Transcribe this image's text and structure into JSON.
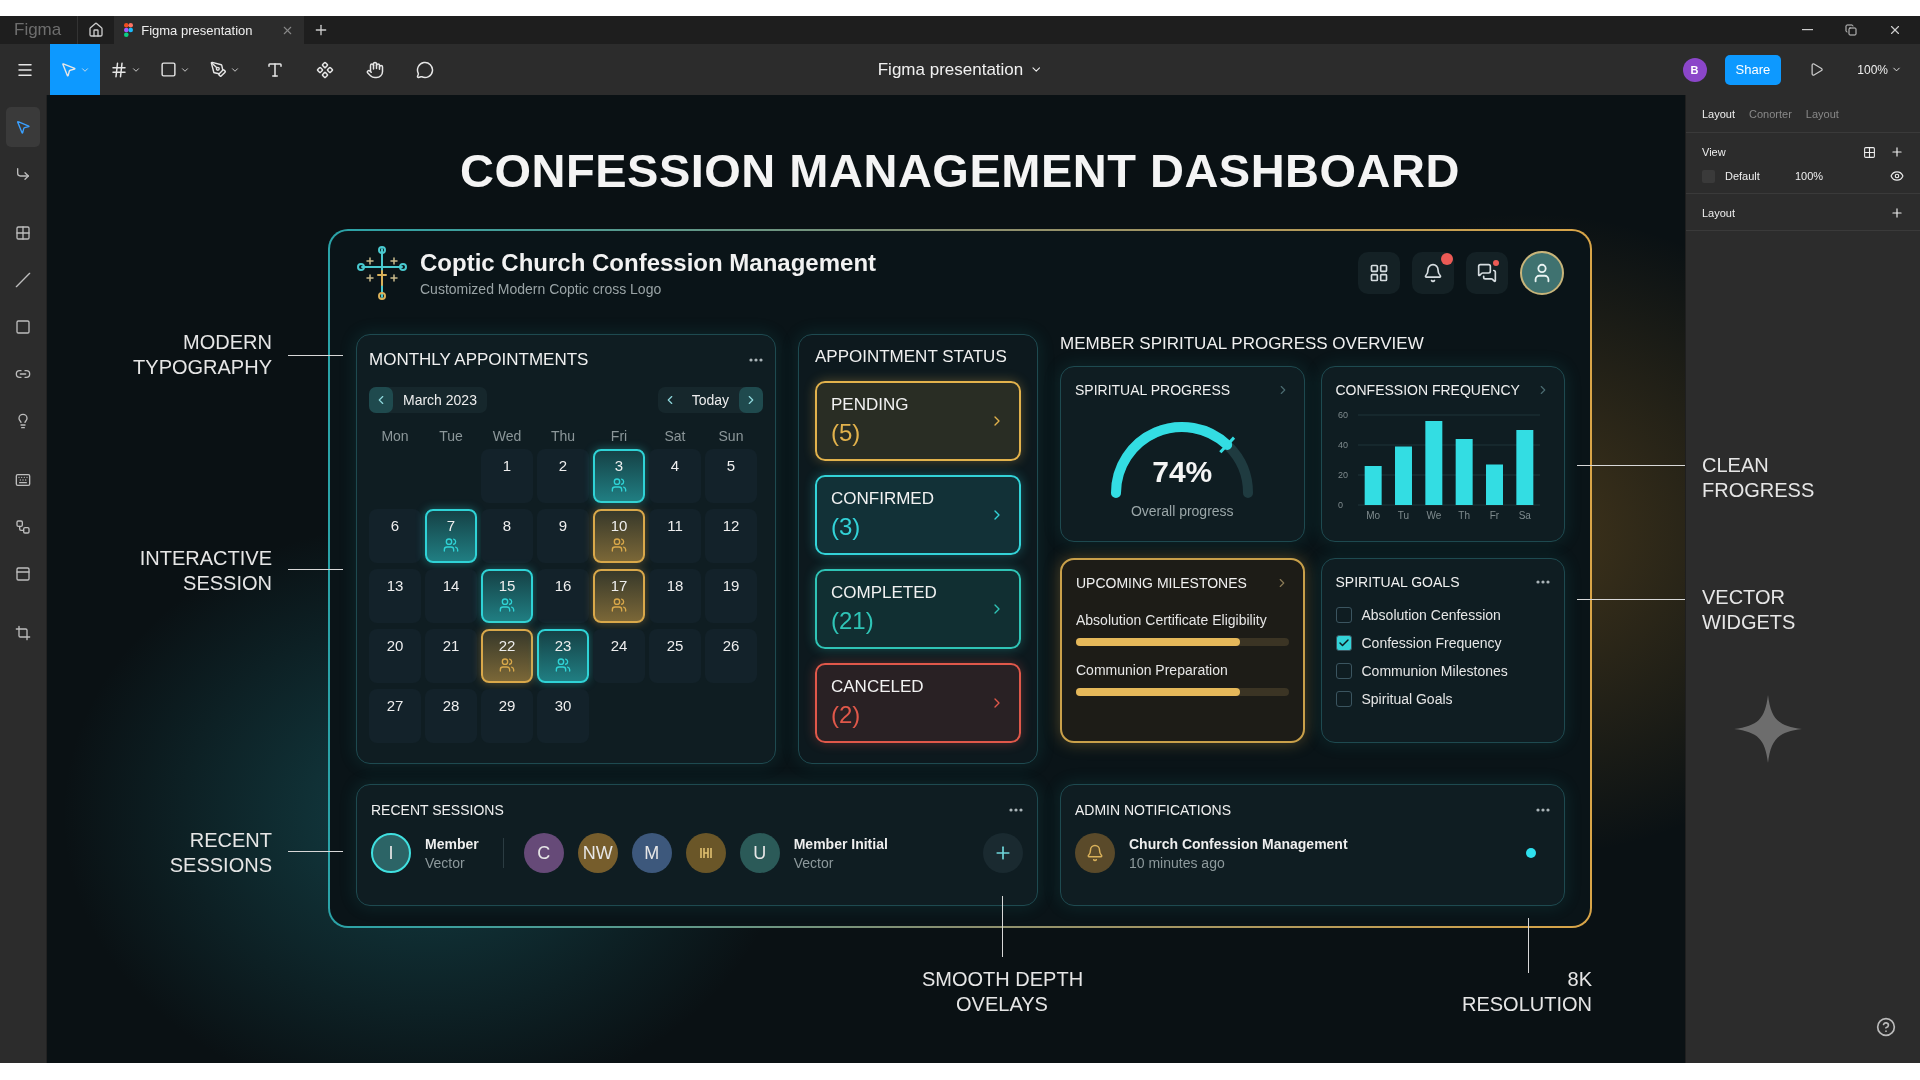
{
  "window": {
    "app_name": "Figma",
    "tab": {
      "title": "Figma presentation",
      "selected": true
    }
  },
  "toolbar": {
    "tools": [
      {
        "kind": "move",
        "selected": true,
        "caret": true
      },
      {
        "kind": "frame",
        "selected": false,
        "caret": true
      },
      {
        "kind": "shape",
        "selected": false,
        "caret": true
      },
      {
        "kind": "pen",
        "selected": false,
        "caret": true
      },
      {
        "kind": "text",
        "selected": false,
        "caret": false
      },
      {
        "kind": "component",
        "selected": false,
        "caret": false
      },
      {
        "kind": "hand",
        "selected": false,
        "caret": false
      },
      {
        "kind": "comment",
        "selected": false,
        "caret": false
      }
    ],
    "file_title": "Figma presentation",
    "user_initial": "B",
    "share_label": "Share",
    "zoom": "100%"
  },
  "side_tools": [
    {
      "kind": "pointer",
      "selected": true
    },
    {
      "kind": "connector",
      "selected": false
    },
    {
      "kind": "grid",
      "selected": false
    },
    {
      "kind": "line",
      "selected": false
    },
    {
      "kind": "rectangle",
      "selected": false
    },
    {
      "kind": "link",
      "selected": false
    },
    {
      "kind": "bulb",
      "selected": false
    },
    {
      "kind": "keyboard",
      "selected": false
    },
    {
      "kind": "nodes",
      "selected": false
    },
    {
      "kind": "panel",
      "selected": false
    },
    {
      "kind": "crop",
      "selected": false
    }
  ],
  "canvas": {
    "title": "CONFESSION MANAGEMENT DASHBOARD",
    "annotations": [
      {
        "lines": [
          "MODERN",
          "TYPOGRAPHY"
        ]
      },
      {
        "lines": [
          "INTERACTIVE",
          "SESSION"
        ]
      },
      {
        "lines": [
          "RECENT",
          "SESSIONS"
        ]
      },
      {
        "lines": [
          "CLEAN",
          "FROGRESS"
        ]
      },
      {
        "lines": [
          "VECTOR",
          "WIDGETS"
        ]
      },
      {
        "lines": [
          "SMOOTH DEPTH",
          "OVELAYS"
        ]
      },
      {
        "lines": [
          "8K",
          "RESOLUTION"
        ]
      }
    ],
    "dashboard": {
      "title": "Coptic Church Confession Management",
      "subtitle": "Customized Modern Coptic cross Logo",
      "header_buttons": [
        {
          "kind": "grid",
          "badge": false
        },
        {
          "kind": "bell",
          "badge": true
        },
        {
          "kind": "chat",
          "badge": true
        }
      ],
      "calendar": {
        "title": "MONTHLY APPOINTMENTS",
        "month": "March 2023",
        "today": "Today",
        "weekdays": [
          "Mon",
          "Tue",
          "Wed",
          "Thu",
          "Fri",
          "Sat",
          "Sun"
        ],
        "weeks": [
          [
            {
              "day": "1"
            },
            {
              "day": "2"
            },
            {
              "day": "3",
              "color": "#2fd3d6"
            },
            {
              "day": "4"
            },
            {
              "day": "5"
            }
          ],
          [
            {
              "day": "6"
            },
            {
              "day": "7",
              "color": "#2fd3d6"
            },
            {
              "day": "8"
            },
            {
              "day": "9"
            },
            {
              "day": "10",
              "color": "#d9a84a"
            },
            {
              "day": "11"
            },
            {
              "day": "12"
            }
          ],
          [
            {
              "day": "13"
            },
            {
              "day": "14"
            },
            {
              "day": "15",
              "color": "#2fd3d6"
            },
            {
              "day": "16"
            },
            {
              "day": "17",
              "color": "#d9a84a"
            },
            {
              "day": "18"
            },
            {
              "day": "19"
            }
          ],
          [
            {
              "day": "20"
            },
            {
              "day": "21"
            },
            {
              "day": "22",
              "color": "#d9a84a"
            },
            {
              "day": "23",
              "color": "#2fd3d6"
            },
            {
              "day": "24"
            },
            {
              "day": "25"
            },
            {
              "day": "26"
            }
          ],
          [
            {
              "day": "27"
            },
            {
              "day": "28"
            },
            {
              "day": "29"
            },
            {
              "day": "30"
            }
          ]
        ]
      },
      "status": {
        "title": "APPOINTMENT STATUS",
        "items": [
          {
            "label": "PENDING",
            "count": "(5)",
            "color": "#e2b24c"
          },
          {
            "label": "CONFIRMED",
            "count": "(3)",
            "color": "#33d3d8"
          },
          {
            "label": "COMPLETED",
            "count": "(21)",
            "color": "#2fc4b6"
          },
          {
            "label": "CANCELED",
            "count": "(2)",
            "color": "#e0584a"
          }
        ]
      },
      "overview": {
        "title": "MEMBER SPIRITUAL PROGRESS OVERVIEW",
        "progress": {
          "title": "SPIRITUAL PROGRESS",
          "value": "74%",
          "caption": "Overall progress"
        },
        "frequency": {
          "title": "CONFESSION FREQUENCY",
          "chart_data": {
            "type": "bar",
            "categories": [
              "Mo",
              "Tu",
              "We",
              "Th",
              "Fr",
              "Sa"
            ],
            "values": [
              26,
              39,
              56,
              44,
              27,
              50
            ],
            "ylim": [
              0,
              60
            ],
            "yticks": [
              0,
              20,
              40,
              60
            ]
          }
        },
        "milestones": {
          "title": "UPCOMING MILESTONES",
          "items": [
            {
              "label": "Absolution Certificate Eligibility",
              "level": 0.77
            },
            {
              "label": "Communion Preparation",
              "level": 0.77
            }
          ]
        },
        "goals": {
          "title": "SPIRITUAL GOALS",
          "items": [
            {
              "label": "Absolution Cenfession",
              "checked": false
            },
            {
              "label": "Confession Frequency",
              "checked": true
            },
            {
              "label": "Communion Milestones",
              "checked": false
            },
            {
              "label": "Spiritual Goals",
              "checked": false
            }
          ]
        }
      },
      "sessions": {
        "title": "RECENT SESSIONS",
        "members": [
          {
            "kind": "letter",
            "initial": "I",
            "color": "#2c6466",
            "selected": true,
            "name": "Member",
            "sub": "Vector"
          },
          {
            "kind": "letter",
            "initial": "C",
            "color": "#664a78",
            "selected": false
          },
          {
            "kind": "letter",
            "initial": "NW",
            "color": "#765d2c",
            "selected": false
          },
          {
            "kind": "letter",
            "initial": "M",
            "color": "#3d587c",
            "selected": false
          },
          {
            "kind": "glyph",
            "color": "#6a5628",
            "selected": false
          },
          {
            "kind": "letter",
            "initial": "U",
            "color": "#2b5a58",
            "selected": false,
            "name": "Member Initial",
            "sub": "Vector"
          }
        ]
      },
      "notifications": {
        "title": "ADMIN NOTIFICATIONS",
        "items": [
          {
            "title": "Church Confession Management",
            "time": "10 minutes ago",
            "unread": true
          }
        ]
      }
    }
  },
  "right_panel": {
    "tabs": [
      {
        "label": "Layout",
        "selected": true
      },
      {
        "label": "Conorter",
        "selected": false
      },
      {
        "label": "Layout",
        "selected": false
      }
    ],
    "view": {
      "title": "View",
      "rows": [
        {
          "label": "Default",
          "value": "100%",
          "checked": false,
          "visible": true
        }
      ]
    },
    "layout": {
      "title": "Layout"
    }
  }
}
